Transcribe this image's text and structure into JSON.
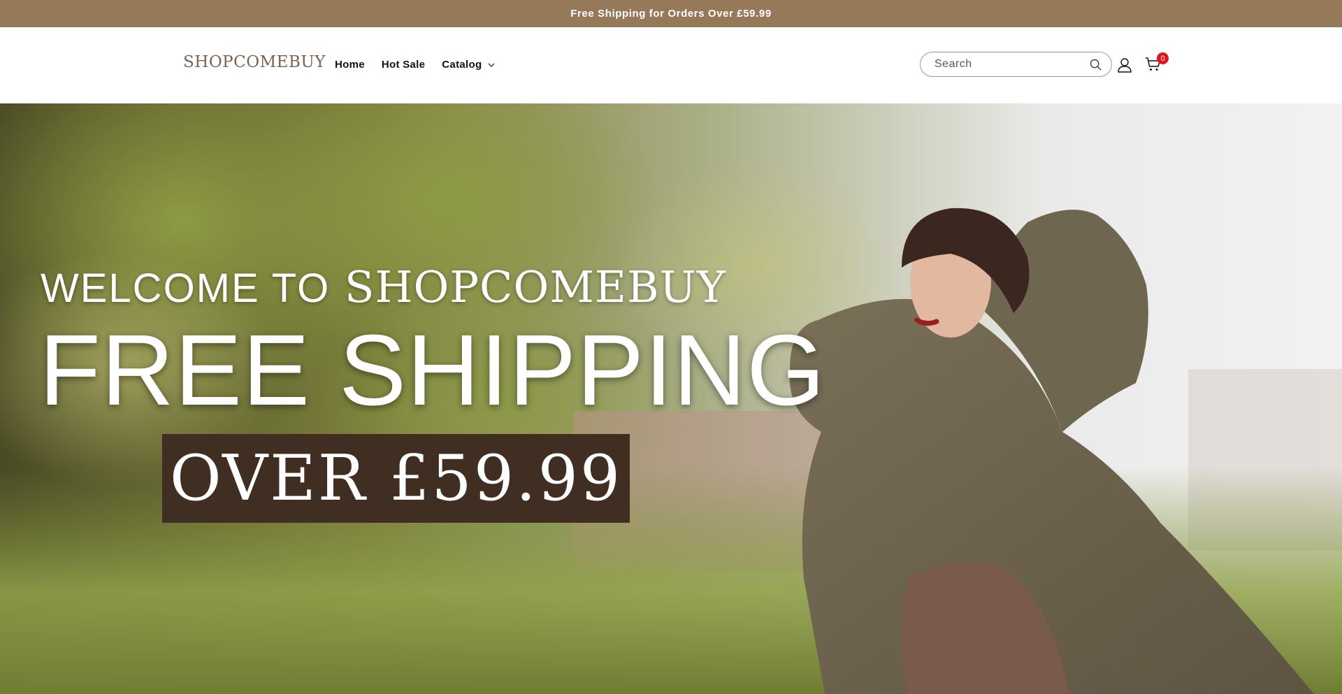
{
  "announcement": {
    "text": "Free Shipping for Orders Over £59.99"
  },
  "header": {
    "logo_text": "SHOPCOMEBUY",
    "nav": [
      {
        "label": "Home"
      },
      {
        "label": "Hot Sale"
      },
      {
        "label": "Catalog"
      }
    ],
    "search": {
      "placeholder": "Search",
      "value": ""
    },
    "cart_count": "0"
  },
  "hero": {
    "welcome_prefix": "WELCOME TO",
    "welcome_brand": "SHOPCOMEBUY",
    "headline": "FREE SHIPPING",
    "price_text": "OVER £59.99"
  },
  "icons": {
    "search": "search-icon",
    "account": "account-icon",
    "cart": "cart-icon",
    "caret": "chevron-down-icon"
  },
  "colors": {
    "announcement_bg": "#957959",
    "price_box_bg": "#3f2e21",
    "cart_badge": "#e0131f",
    "logo": "#7a6450"
  }
}
